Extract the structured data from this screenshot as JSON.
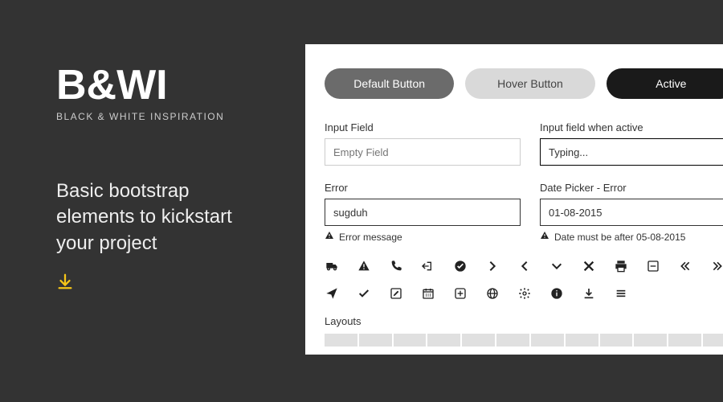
{
  "brand": {
    "logo": "B&WI",
    "logo_subtitle": "BLACK & WHITE INSPIRATION",
    "tagline": "Basic bootstrap elements to kickstart your project"
  },
  "buttons": {
    "default": "Default Button",
    "hover": "Hover Button",
    "active": "Active"
  },
  "inputs": {
    "empty_label": "Input Field",
    "empty_placeholder": "Empty Field",
    "active_label": "Input field when active",
    "active_value": "Typing...",
    "error_label": "Error",
    "error_value": "sugduh",
    "error_message": "Error message",
    "date_label": "Date Picker - Error",
    "date_value": "01-08-2015",
    "date_message": "Date must be after 05-08-2015"
  },
  "section": {
    "layouts": "Layouts"
  },
  "icons": {
    "row1": [
      "truck-icon",
      "warning-icon",
      "phone-icon",
      "signout-icon",
      "check-circle-icon",
      "chevron-right-icon",
      "chevron-left-icon",
      "chevron-down-icon",
      "close-icon",
      "print-icon",
      "minus-square-icon",
      "double-chevron-left-icon",
      "double-chevron-right-icon"
    ],
    "row2": [
      "send-icon",
      "check-icon",
      "edit-square-icon",
      "calendar-icon",
      "plus-square-icon",
      "globe-icon",
      "gear-icon",
      "info-icon",
      "download-icon",
      "menu-icon"
    ]
  }
}
